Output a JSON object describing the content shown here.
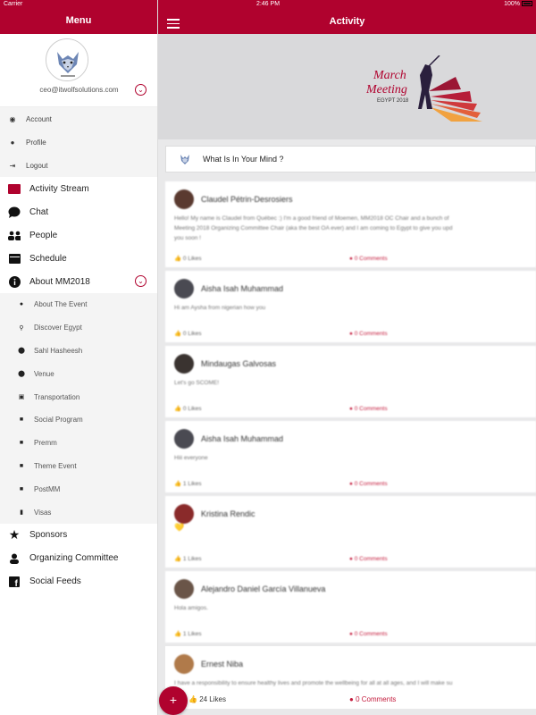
{
  "status_bar": {
    "carrier": "Carrier",
    "time": "2:46 PM",
    "battery": "100%"
  },
  "sidebar": {
    "title": "Menu",
    "email": "ceo@itwolfsolutions.com",
    "account_items": [
      {
        "label": "Account",
        "icon": "account-icon"
      },
      {
        "label": "Profile",
        "icon": "profile-icon"
      },
      {
        "label": "Logout",
        "icon": "logout-icon"
      }
    ],
    "menu_items": [
      {
        "label": "Activity Stream",
        "icon": "activity-stream-icon"
      },
      {
        "label": "Chat",
        "icon": "chat-icon"
      },
      {
        "label": "People",
        "icon": "people-icon"
      },
      {
        "label": "Schedule",
        "icon": "calendar-icon"
      },
      {
        "label": "About MM2018",
        "icon": "info-icon"
      }
    ],
    "about_sub_items": [
      {
        "label": "About The Event",
        "icon": "info-icon"
      },
      {
        "label": "Discover Egypt",
        "icon": "search-icon"
      },
      {
        "label": "Sahl Hasheesh",
        "icon": "map-pin-icon"
      },
      {
        "label": "Venue",
        "icon": "map-pin-icon"
      },
      {
        "label": "Transportation",
        "icon": "bus-icon"
      },
      {
        "label": "Social Program",
        "icon": "briefcase-icon"
      },
      {
        "label": "Premm",
        "icon": "briefcase-icon"
      },
      {
        "label": "Theme Event",
        "icon": "briefcase-icon"
      },
      {
        "label": "PostMM",
        "icon": "briefcase-icon"
      },
      {
        "label": "Visas",
        "icon": "document-icon"
      }
    ],
    "bottom_items": [
      {
        "label": "Sponsors",
        "icon": "star-icon"
      },
      {
        "label": "Organizing Committee",
        "icon": "person-icon"
      },
      {
        "label": "Social Feeds",
        "icon": "facebook-icon"
      }
    ]
  },
  "main": {
    "title": "Activity",
    "banner": {
      "line1": "March",
      "line2": "Meeting",
      "line3": "EGYPT 2018"
    },
    "compose_placeholder": "What Is In Your Mind ?",
    "posts": [
      {
        "name": "Claudel Pétrin-Desrosiers",
        "text": "Hello! My name is Claudel from Québec :) I'm a good friend of Moemen, MM2018 OC Chair and a bunch of",
        "text2": "Meeting 2018 Organizing Committee Chair (aka the best OA ever) and I am coming to Egypt to give you upd",
        "text3": "you soon !",
        "likes": "0 Likes",
        "comments": "0 Comments",
        "avatar_color": "#5a3a30"
      },
      {
        "name": "Aisha Isah Muhammad",
        "text": "Hi am Aysha from nigerian how you",
        "likes": "0 Likes",
        "comments": "0 Comments",
        "avatar_color": "#4a4a52"
      },
      {
        "name": "Mindaugas Galvosas",
        "text": "Let's go SCOME!",
        "likes": "0 Likes",
        "comments": "0 Comments",
        "avatar_color": "#3a3330"
      },
      {
        "name": "Aisha Isah Muhammad",
        "text": "Hiii everyone",
        "likes": "1 Likes",
        "comments": "0 Comments",
        "avatar_color": "#4a4a52"
      },
      {
        "name": "Kristina Rendic",
        "text": "",
        "emoji": "💛",
        "likes": "1 Likes",
        "comments": "0 Comments",
        "avatar_color": "#8a2a2a"
      },
      {
        "name": "Alejandro Daniel García Villanueva",
        "text": "Hola amigos.",
        "likes": "1 Likes",
        "comments": "0 Comments",
        "avatar_color": "#6a5548"
      },
      {
        "name": "Ernest Niba",
        "text": "I have a responsibility to ensure healthy lives and promote the wellbeing for all at all ages, and I will make su",
        "likes": "24 Likes",
        "comments": "0 Comments",
        "avatar_color": "#b07a4a"
      }
    ]
  },
  "fab_label": "+",
  "colors": {
    "brand": "#b0022e",
    "comment": "#c41c3d"
  }
}
